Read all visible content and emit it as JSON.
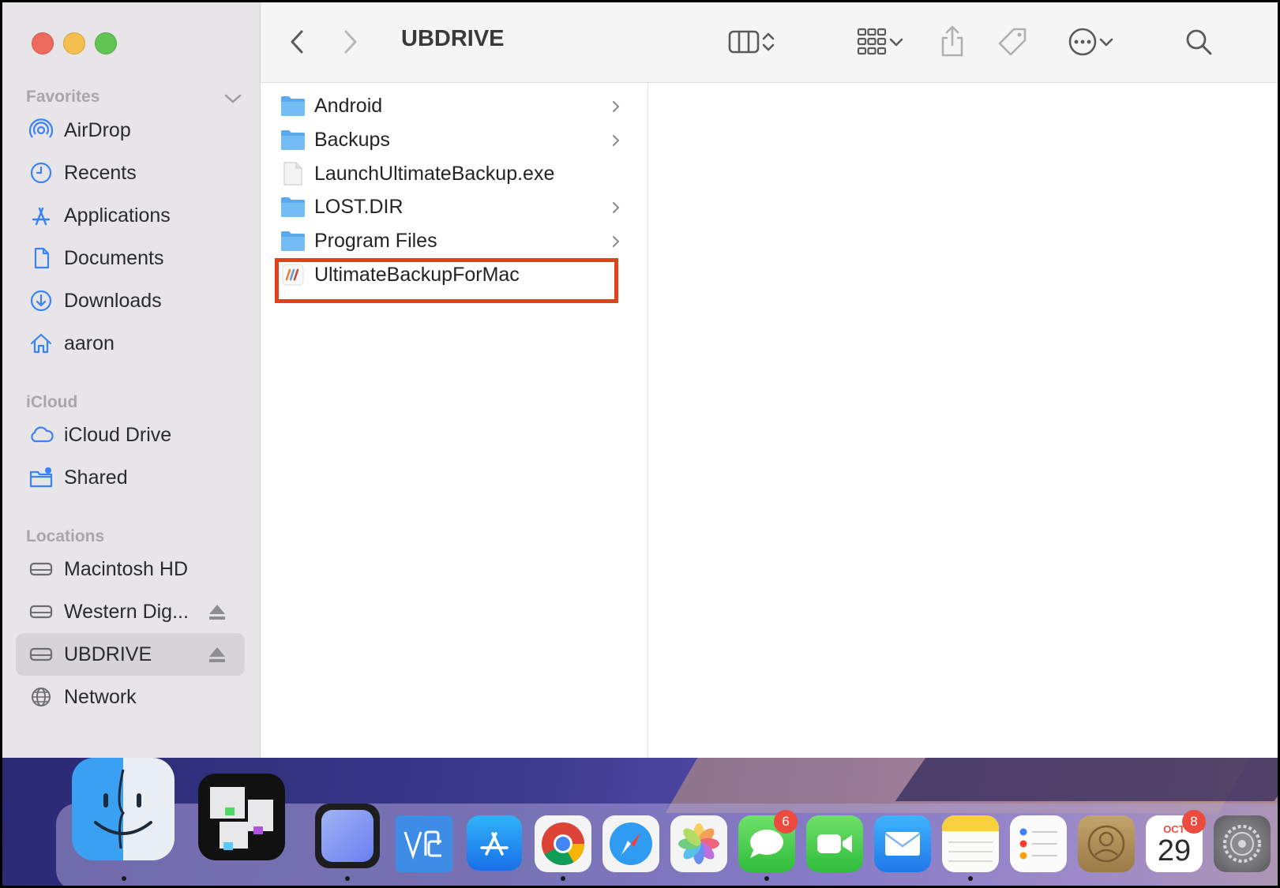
{
  "window": {
    "title": "UBDRIVE"
  },
  "sidebar": {
    "favorites_label": "Favorites",
    "icloud_label": "iCloud",
    "locations_label": "Locations",
    "favorites": [
      {
        "label": "AirDrop",
        "icon": "airdrop-icon"
      },
      {
        "label": "Recents",
        "icon": "clock-icon"
      },
      {
        "label": "Applications",
        "icon": "applications-icon"
      },
      {
        "label": "Documents",
        "icon": "document-icon"
      },
      {
        "label": "Downloads",
        "icon": "download-icon"
      },
      {
        "label": "aaron",
        "icon": "home-icon"
      }
    ],
    "icloud": [
      {
        "label": "iCloud Drive",
        "icon": "cloud-icon"
      },
      {
        "label": "Shared",
        "icon": "shared-folder-icon"
      }
    ],
    "locations": [
      {
        "label": "Macintosh HD",
        "icon": "drive-icon"
      },
      {
        "label": "Western Dig...",
        "icon": "drive-icon",
        "ejectable": true
      },
      {
        "label": "UBDRIVE",
        "icon": "drive-icon",
        "ejectable": true,
        "selected": true
      },
      {
        "label": "Network",
        "icon": "globe-icon"
      }
    ]
  },
  "files": [
    {
      "name": "Android",
      "type": "folder"
    },
    {
      "name": "Backups",
      "type": "folder"
    },
    {
      "name": "LaunchUltimateBackup.exe",
      "type": "file"
    },
    {
      "name": "LOST.DIR",
      "type": "folder"
    },
    {
      "name": "Program Files",
      "type": "folder"
    },
    {
      "name": "UltimateBackupForMac",
      "type": "app",
      "highlighted": true
    }
  ],
  "highlight_color": "#e5401e",
  "accent_color": "#3b82f6",
  "dock": {
    "messages_badge": "6",
    "calendar_badge": "8",
    "calendar_month": "OCT",
    "calendar_day": "29"
  }
}
